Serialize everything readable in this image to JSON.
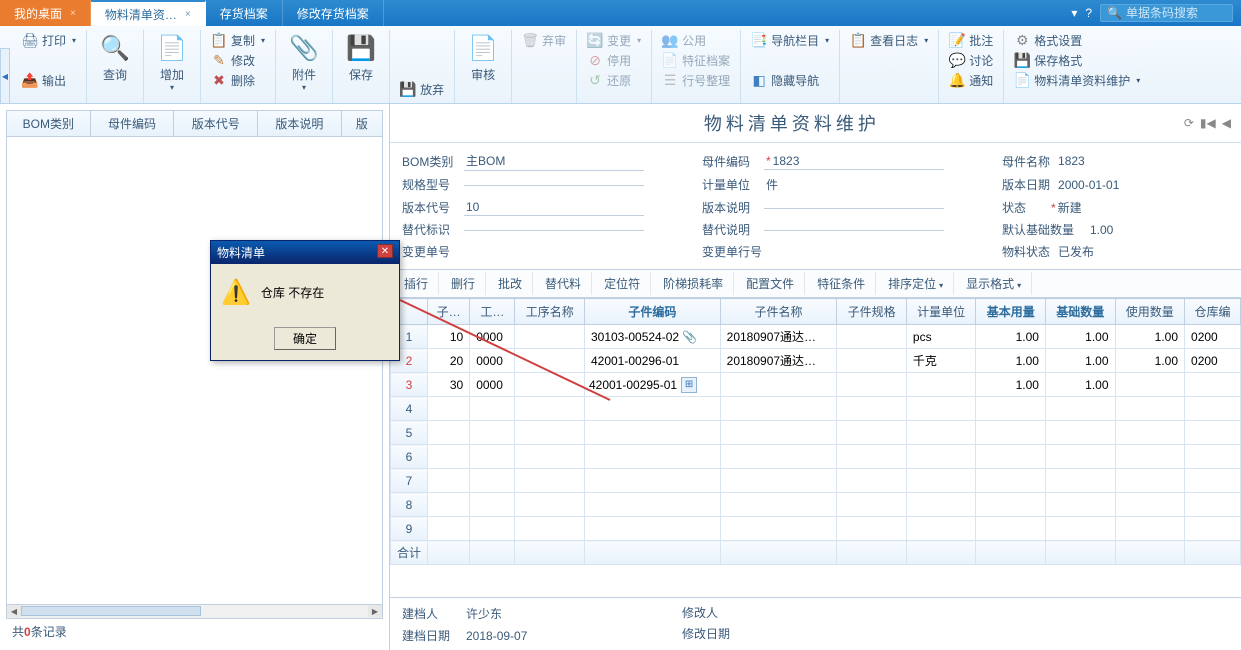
{
  "tabs": {
    "desktop": "我的桌面",
    "bom": "物料清单资…",
    "inventory": "存货档案",
    "modify_inventory": "修改存货档案"
  },
  "search": {
    "placeholder": "单据条码搜索"
  },
  "ribbon": {
    "print": "打印",
    "export": "输出",
    "query": "查询",
    "add": "增加",
    "copy": "复制",
    "edit": "修改",
    "delete": "删除",
    "attach": "附件",
    "save": "保存",
    "discard": "放弃",
    "audit": "审核",
    "trash": "弃审",
    "change": "变更",
    "stop": "停用",
    "restore": "还原",
    "public": "公用",
    "feature": "特征档案",
    "row": "行号整理",
    "navbar": "导航栏目",
    "hide_nav": "隐藏导航",
    "log": "查看日志",
    "batch": "批注",
    "discuss": "讨论",
    "notify": "通知",
    "format_set": "格式设置",
    "save_format": "保存格式",
    "maintain": "物料清单资料维护"
  },
  "left": {
    "headers": [
      "BOM类别",
      "母件编码",
      "版本代号",
      "版本说明",
      "版"
    ],
    "count_prefix": "共",
    "count": "0",
    "count_suffix": "条记录"
  },
  "dialog": {
    "title": "物料清单",
    "message": "仓库  不存在",
    "ok": "确定"
  },
  "page_title": "物料清单资料维护",
  "form": {
    "bom_type_label": "BOM类别",
    "bom_type": "主BOM",
    "parent_code_label": "母件编码",
    "parent_code": "1823",
    "parent_name_label": "母件名称",
    "parent_name": "1823",
    "spec_label": "规格型号",
    "spec": "",
    "unit_label": "计量单位",
    "unit": "件",
    "ver_date_label": "版本日期",
    "ver_date": "2000-01-01",
    "ver_code_label": "版本代号",
    "ver_code": "10",
    "ver_desc_label": "版本说明",
    "ver_desc": "",
    "status_label": "状态",
    "status": "新建",
    "alt_label": "替代标识",
    "alt": "",
    "alt_desc_label": "替代说明",
    "alt_desc": "",
    "def_qty_label": "默认基础数量",
    "def_qty": "1.00",
    "change_no_label": "变更单号",
    "change_no": "",
    "change_row_label": "变更单行号",
    "change_row": "",
    "mat_status_label": "物料状态",
    "mat_status": "已发布"
  },
  "grid_toolbar": {
    "insert": "插行",
    "delete": "删行",
    "batch": "批改",
    "alt": "替代料",
    "locator": "定位符",
    "loss_rate": "阶梯损耗率",
    "config": "配置文件",
    "feature": "特征条件",
    "sort": "排序定位",
    "display": "显示格式"
  },
  "grid_headers": [
    "子…",
    "工…",
    "工序名称",
    "子件编码",
    "子件名称",
    "子件规格",
    "计量单位",
    "基本用量",
    "基础数量",
    "使用数量",
    "仓库编"
  ],
  "grid_rows": [
    {
      "num": "1",
      "c1": "10",
      "c2": "0000",
      "c3": "",
      "code": "30103-00524-02",
      "clip": true,
      "name": "20180907通达…",
      "spec": "",
      "unit": "pcs",
      "base": "1.00",
      "qty": "1.00",
      "use": "1.00",
      "wh": "0200"
    },
    {
      "num": "2",
      "c1": "20",
      "c2": "0000",
      "c3": "",
      "code": "42001-00296-01",
      "clip": false,
      "name": "20180907通达…",
      "spec": "",
      "unit": "千克",
      "base": "1.00",
      "qty": "1.00",
      "use": "1.00",
      "wh": "0200",
      "red": true
    },
    {
      "num": "3",
      "c1": "30",
      "c2": "0000",
      "c3": "",
      "code": "42001-00295-01",
      "clip": false,
      "name": "",
      "spec": "",
      "unit": "",
      "base": "1.00",
      "qty": "1.00",
      "use": "",
      "wh": "",
      "red": true,
      "editing": true
    }
  ],
  "total_label": "合计",
  "bottom": {
    "creator_label": "建档人",
    "creator": "许少东",
    "modifier_label": "修改人",
    "modifier": "",
    "create_date_label": "建档日期",
    "create_date": "2018-09-07",
    "modify_date_label": "修改日期",
    "modify_date": ""
  }
}
